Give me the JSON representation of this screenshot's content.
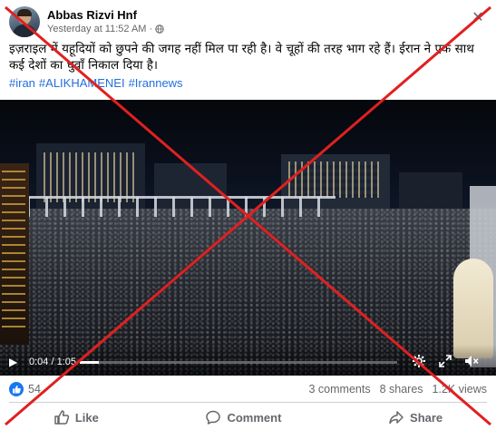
{
  "post": {
    "author": "Abbas Rizvi Hnf",
    "timestamp": "Yesterday at 11:52 AM",
    "separator": "·",
    "text": "इज़राइल में यहूदियों को छुपने की जगह नहीं मिल पा रही है। वे चूहों की तरह भाग रहे हैं। ईरान ने एक साथ कई देशों का धुवाँ निकाल दिया है।",
    "hashtags": [
      "#iran",
      "#ALIKHAMENEI",
      "#Irannews"
    ]
  },
  "video": {
    "current_time": "0:04",
    "duration": "1:05",
    "time_separator": " / ",
    "progress": 0.06
  },
  "stats": {
    "reactions": "54",
    "comments": "3 comments",
    "shares": "8 shares",
    "views": "1.2K views"
  },
  "actions": {
    "like": "Like",
    "comment": "Comment",
    "share": "Share"
  },
  "colors": {
    "accent": "#1877f2",
    "hashtag": "#216fdb",
    "muted": "#65676b",
    "overlay_cross": "#e02020"
  },
  "icons": [
    "globe-icon",
    "close-icon",
    "play-icon",
    "settings-icon",
    "fullscreen-icon",
    "volume-muted-icon",
    "like-icon",
    "comment-icon",
    "share-icon"
  ]
}
